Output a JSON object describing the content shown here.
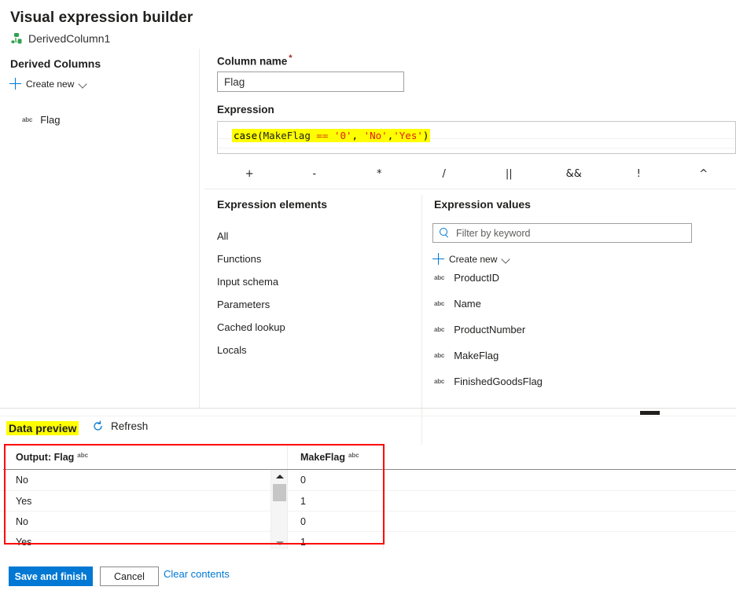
{
  "header": {
    "title": "Visual expression builder",
    "transform_name": "DerivedColumn1",
    "transform_icon": "derived-column-icon"
  },
  "left_panel": {
    "heading": "Derived Columns",
    "create_new_label": "Create new",
    "create_new_icon": "plus-icon",
    "chevron_icon": "chevron-down-icon",
    "columns": [
      {
        "type_badge": "abc",
        "label": "Flag"
      }
    ]
  },
  "main": {
    "column_name_label": "Column name",
    "required_marker": "*",
    "column_name_value": "Flag",
    "column_name_placeholder": "Column name",
    "expression_label": "Expression",
    "expression_tokens": [
      {
        "text": "case(",
        "kind": "plain"
      },
      {
        "text": "MakeFlag",
        "kind": "ident"
      },
      {
        "text": " == ",
        "kind": "op"
      },
      {
        "text": "'0'",
        "kind": "str"
      },
      {
        "text": ", ",
        "kind": "plain"
      },
      {
        "text": "'No'",
        "kind": "str"
      },
      {
        "text": ",",
        "kind": "plain"
      },
      {
        "text": "'Yes'",
        "kind": "str"
      },
      {
        "text": ")",
        "kind": "plain"
      }
    ],
    "expression_text": "case(MakeFlag == '0', 'No','Yes')",
    "operators": [
      "+",
      "-",
      "*",
      "/",
      "||",
      "&&",
      "!",
      "^"
    ]
  },
  "expression_elements": {
    "heading": "Expression elements",
    "items": [
      "All",
      "Functions",
      "Input schema",
      "Parameters",
      "Cached lookup",
      "Locals"
    ]
  },
  "expression_values": {
    "heading": "Expression values",
    "filter_placeholder": "Filter by keyword",
    "filter_value": "",
    "search_icon": "search-icon",
    "create_new_label": "Create new",
    "items": [
      {
        "type_badge": "abc",
        "label": "ProductID"
      },
      {
        "type_badge": "abc",
        "label": "Name"
      },
      {
        "type_badge": "abc",
        "label": "ProductNumber"
      },
      {
        "type_badge": "abc",
        "label": "MakeFlag"
      },
      {
        "type_badge": "abc",
        "label": "FinishedGoodsFlag"
      }
    ]
  },
  "data_preview": {
    "title": "Data preview",
    "refresh_label": "Refresh",
    "refresh_icon": "refresh-icon",
    "columns": [
      {
        "label": "Output: Flag",
        "type_badge": "abc"
      },
      {
        "label": "MakeFlag",
        "type_badge": "abc"
      }
    ],
    "rows": [
      {
        "flag": "No",
        "makeflag": "0"
      },
      {
        "flag": "Yes",
        "makeflag": "1"
      },
      {
        "flag": "No",
        "makeflag": "0"
      },
      {
        "flag": "Yes",
        "makeflag": "1"
      }
    ]
  },
  "footer": {
    "save_label": "Save and finish",
    "cancel_label": "Cancel",
    "clear_label": "Clear contents"
  },
  "colors": {
    "accent": "#0078d4",
    "highlight": "#ffff00",
    "annotation": "#ff0000",
    "required": "#a4262c",
    "transform_green": "#30a14e"
  }
}
